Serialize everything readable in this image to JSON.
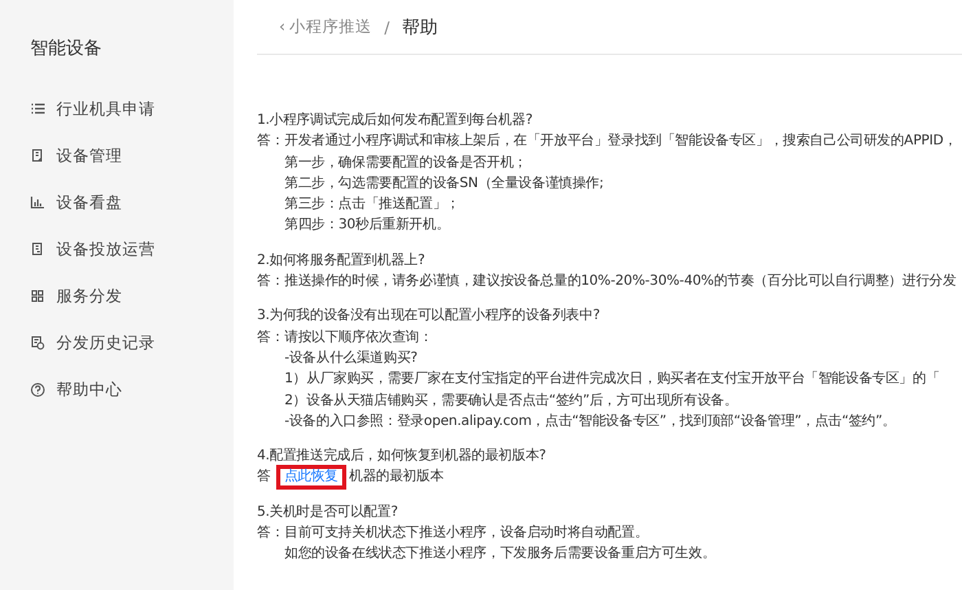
{
  "sidebar": {
    "title": "智能设备",
    "items": [
      {
        "label": "行业机具申请"
      },
      {
        "label": "设备管理"
      },
      {
        "label": "设备看盘"
      },
      {
        "label": "设备投放运营"
      },
      {
        "label": "服务分发"
      },
      {
        "label": "分发历史记录"
      },
      {
        "label": "帮助中心"
      }
    ]
  },
  "breadcrumb": {
    "back": "‹",
    "parent": "小程序推送",
    "separator": "/",
    "current": "帮助"
  },
  "faq": [
    {
      "question": "1.小程序调试完成后如何发布配置到每台机器?",
      "answer_label": "答：",
      "answer_lines": [
        "开发者通过小程序调试和审核上架后，在「开放平台」登录找到「智能设备专区」，搜索自己公司研发的APPID，",
        "第一步，确保需要配置的设备是否开机；",
        "第二步，勾选需要配置的设备SN（全量设备谨慎操作;",
        "第三步：点击「推送配置」；",
        "第四步：30秒后重新开机。"
      ]
    },
    {
      "question": "2.如何将服务配置到机器上?",
      "answer_label": "答：",
      "answer_lines": [
        "推送操作的时候，请务必谨慎，建议按设备总量的10%-20%-30%-40%的节奏（百分比可以自行调整）进行分发"
      ]
    },
    {
      "question": "3.为何我的设备没有出现在可以配置小程序的设备列表中?",
      "answer_label": "答：",
      "answer_lines": [
        "请按以下顺序依次查询：",
        "-设备从什么渠道购买?",
        "1）从厂家购买，需要厂家在支付宝指定的平台进件完成次日，购买者在支付宝开放平台「智能设备专区」的「",
        "2）设备从天猫店铺购买，需要确认是否点击“签约”后，方可出现所有设备。",
        "-设备的入口参照：登录open.alipay.com，点击“智能设备专区”，找到顶部“设备管理”，点击“签约”。"
      ]
    },
    {
      "question": "4.配置推送完成后，如何恢复到机器的最初版本?",
      "answer_label": "答",
      "link": "点此恢复",
      "highlighted": true,
      "answer_lines": [
        "机器的最初版本"
      ]
    },
    {
      "question": "5.关机时是否可以配置?",
      "answer_label": "答：",
      "answer_lines": [
        "目前可支持关机状态下推送小程序，设备启动时将自动配置。",
        "如您的设备在线状态下推送小程序，下发服务后需要设备重启方可生效。"
      ]
    }
  ]
}
